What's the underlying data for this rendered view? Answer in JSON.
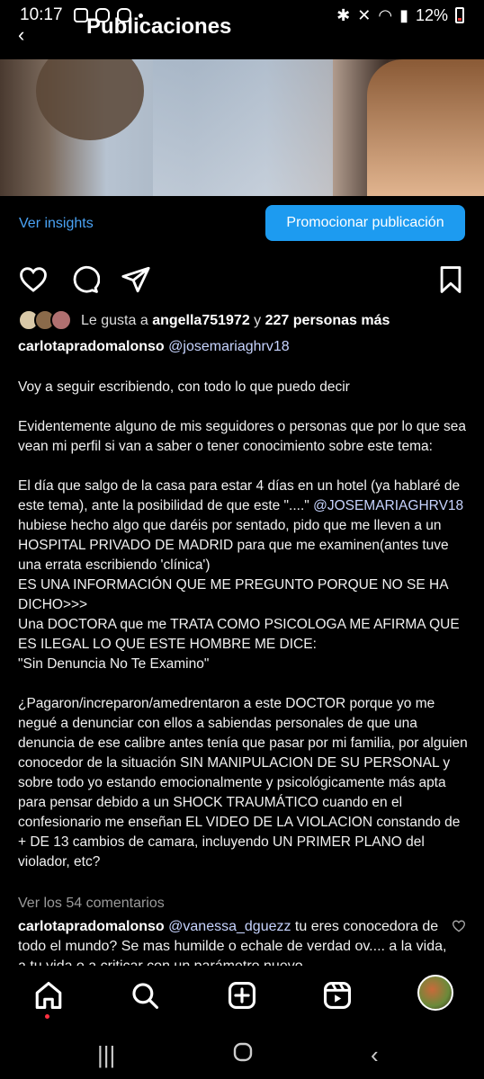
{
  "status_bar": {
    "time": "10:17",
    "battery": "12%"
  },
  "header": {
    "title": "Publicaciones"
  },
  "insights": {
    "link_label": "Ver insights",
    "promote_label": "Promocionar publicación"
  },
  "likes": {
    "prefix": "Le gusta a",
    "user": "angella751972",
    "connector": "y",
    "others": "227 personas más"
  },
  "post": {
    "author": "carlotapradomalonso",
    "mention": "@josemariaghrv18",
    "paragraphs": [
      "Voy a seguir escribiendo, con todo lo que puedo decir",
      "Evidentemente alguno de mis seguidores o personas que por lo que sea vean mi perfil si van a saber o tener conocimiento sobre este tema:"
    ],
    "p3_before": "El día que salgo de la casa para estar 4 días en un hotel (ya hablaré de este tema), ante la posibilidad de que este \"....\" ",
    "p3_mention": "@JOSEMARIAGHRV18",
    "p3_after": " hubiese hecho algo que daréis por sentado, pido que me lleven a un HOSPITAL PRIVADO DE MADRID para que me examinen(antes tuve una errata escribiendo 'clínica')\nES UNA INFORMACIÓN QUE ME PREGUNTO PORQUE NO SE HA DICHO>>>\nUna DOCTORA que me TRATA COMO PSICOLOGA ME AFIRMA QUE ES ILEGAL LO QUE ESTE HOMBRE ME DICE:\n\"Sin Denuncia No Te Examino\"",
    "p4": "¿Pagaron/increparon/amedrentaron a este DOCTOR porque yo me negué a denunciar con ellos a sabiendas personales de que una denuncia de ese calibre antes tenía que pasar por mi familia, por alguien conocedor de la situación SIN MANIPULACION DE SU PERSONAL y sobre todo  yo estando emocionalmente y psicológicamente más apta para pensar debido a un SHOCK TRAUMÁTICO cuando en el confesionario me enseñan EL VIDEO DE LA VIOLACION constando de + DE 13 cambios de camara, incluyendo UN PRIMER PLANO del violador, etc?"
  },
  "comments": {
    "view_all": "Ver los 54 comentarios",
    "first": {
      "user": "carlotapradomalonso",
      "mention": "@vanessa_dguezz",
      "text": " tu eres conocedora de todo el mundo? Se mas humilde o echale de verdad ov.... a la vida, a tu vida o a criticar con un parámetro nuevo"
    }
  },
  "icons": {
    "actions": [
      "heart-icon",
      "comment-icon",
      "share-icon",
      "bookmark-icon"
    ],
    "nav": [
      "home-icon",
      "search-icon",
      "create-icon",
      "reels-icon",
      "profile-avatar"
    ],
    "system": [
      "recents-icon",
      "home-circle-icon",
      "back-icon"
    ]
  },
  "colors": {
    "accent": "#1d9bf0",
    "link": "#4aa3f5",
    "notification": "#ff3040"
  }
}
